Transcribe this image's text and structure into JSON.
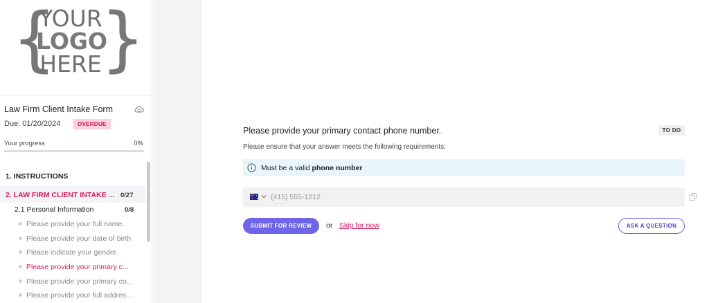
{
  "logo": {
    "brace_left": "{",
    "brace_right": "}",
    "line1": "YOUR",
    "line2": "LOGO",
    "line3": "HERE"
  },
  "form": {
    "title": "Law Firm Client Intake Form",
    "due_text": "Due:  01/20/2024",
    "status_badge": "OVERDUE",
    "progress_label": "Your progress",
    "progress_text": "0%",
    "progress_value": 0
  },
  "nav": {
    "section1": "1. INSTRUCTIONS",
    "section2": "2. LAW FIRM CLIENT INTAKE ...",
    "section2_count": "0/27",
    "subsection": "2.1 Personal Information",
    "subsection_count": "0/8",
    "items": [
      {
        "label": "Please provide your full name."
      },
      {
        "label": "Please provide your date of birth"
      },
      {
        "label": "Please indicate your gender."
      },
      {
        "label": "Please provide your primary c..."
      },
      {
        "label": "Please provide your primary co..."
      },
      {
        "label": "Please provide your full addres..."
      }
    ]
  },
  "question": {
    "title": "Please provide your primary contact phone number.",
    "status": "TO DO",
    "subtitle": "Please ensure that your answer meets the following requirements:",
    "requirement_prefix": "Must be a valid",
    "requirement_bold": "phone number",
    "phone_placeholder": "(415) 555-1212"
  },
  "actions": {
    "submit": "SUBMIT FOR REVIEW",
    "or": "or",
    "skip": "Skip for now",
    "ask": "ASK A QUESTION"
  },
  "colors": {
    "accent": "#6f65e8",
    "highlight": "#d81b60",
    "info_bg": "#e8f5fb",
    "overdue_bg": "#fbd0dc"
  },
  "icons": {
    "cloud": "cloud-sync-icon",
    "info": "info-icon",
    "flag": "australia-flag-icon",
    "chevron": "chevron-down-icon",
    "copy": "copy-icon"
  }
}
